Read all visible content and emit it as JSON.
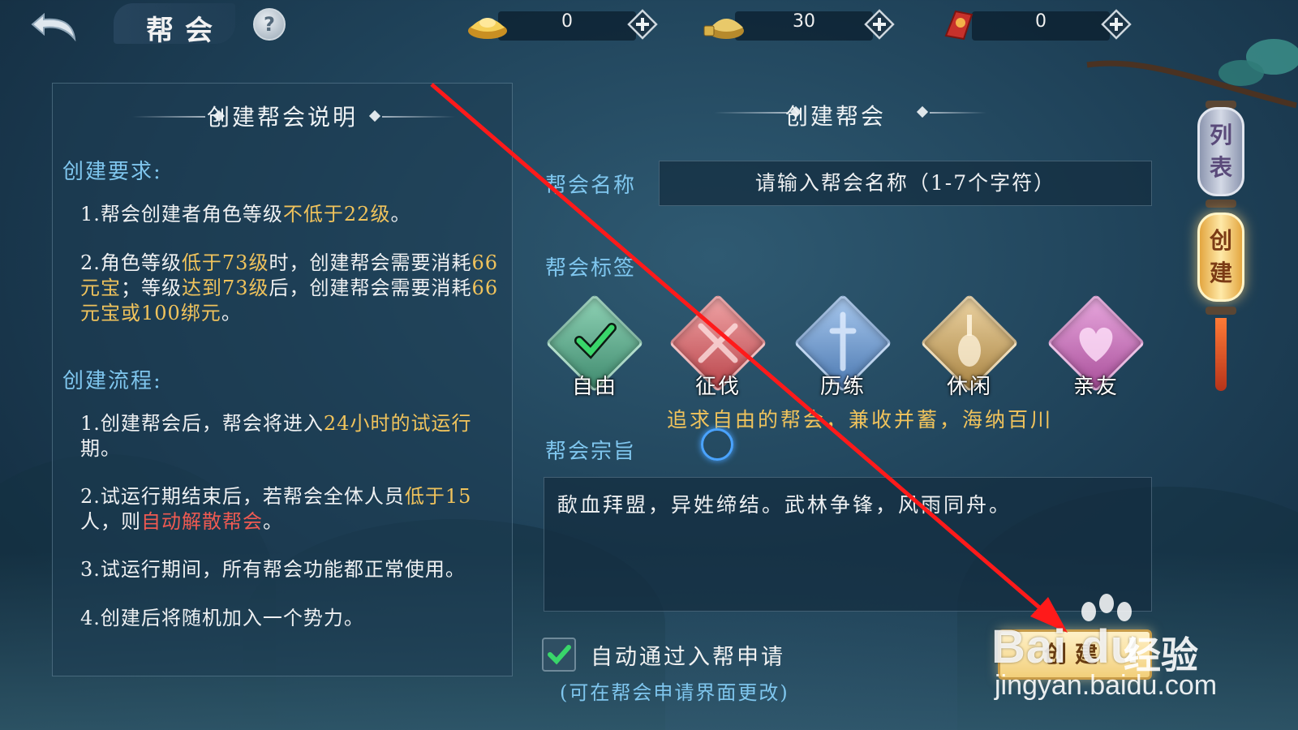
{
  "header": {
    "title": "帮会",
    "help_label": "?"
  },
  "currencies": [
    {
      "name": "gold-ingot-icon",
      "value": "0"
    },
    {
      "name": "bound-ingot-icon",
      "value": "30"
    },
    {
      "name": "red-token-icon",
      "value": "0"
    }
  ],
  "left_panel": {
    "title": "创建帮会说明",
    "requirements_title": "创建要求:",
    "req1": {
      "a": "1.帮会创建者角色等级",
      "b": "不低于22级",
      "c": "。"
    },
    "req2": {
      "a": "2.角色等级",
      "b": "低于73级",
      "c": "时，创建帮会需要消耗",
      "d": "66元宝",
      "e": "；等级",
      "f": "达到73级",
      "g": "后，创建帮会需要消耗",
      "h": "66元宝或100绑元",
      "i": "。"
    },
    "process_title": "创建流程:",
    "proc1": {
      "a": "1.创建帮会后，帮会将进入",
      "b": "24小时的试运行",
      "c": "期。"
    },
    "proc2": {
      "a": "2.试运行期结束后，若帮会全体人员",
      "b": "低于15",
      "c": "人，则",
      "d": "自动解散帮会",
      "e": "。"
    },
    "proc3": "3.试运行期间，所有帮会功能都正常使用。",
    "proc4": "4.创建后将随机加入一个势力。"
  },
  "create_form": {
    "title": "创建帮会",
    "name_label": "帮会名称",
    "name_placeholder": "请输入帮会名称（1-7个字符）",
    "tags_label": "帮会标签",
    "tags": [
      {
        "label": "自由",
        "color": "#5fae8e",
        "selected": true
      },
      {
        "label": "征伐",
        "color": "#d9656a",
        "selected": false
      },
      {
        "label": "历练",
        "color": "#5f8fc4",
        "selected": false
      },
      {
        "label": "休闲",
        "color": "#c8a262",
        "selected": false
      },
      {
        "label": "亲友",
        "color": "#c26fb2",
        "selected": false
      }
    ],
    "tag_description": "追求自由的帮会，兼收并蓄，海纳百川",
    "purpose_label": "帮会宗旨",
    "purpose_value": "歃血拜盟，异姓缔结。武林争锋，风雨同舟。",
    "auto_accept_label": "自动通过入帮申请",
    "auto_accept_checked": true,
    "auto_accept_hint": "(可在帮会申请界面更改)",
    "create_button": "创建"
  },
  "side_tabs": [
    {
      "label1": "列",
      "label2": "表"
    },
    {
      "label1": "创",
      "label2": "建"
    }
  ],
  "watermark": {
    "brand": "Bai  du",
    "jingyan": "经验",
    "url": "jingyan.baidu.com"
  },
  "colors": {
    "accent_blue": "#7fc6ee",
    "highlight_yellow": "#f0c35c",
    "warning_red": "#f05a52",
    "annotation_arrow": "#ff1a1a"
  }
}
